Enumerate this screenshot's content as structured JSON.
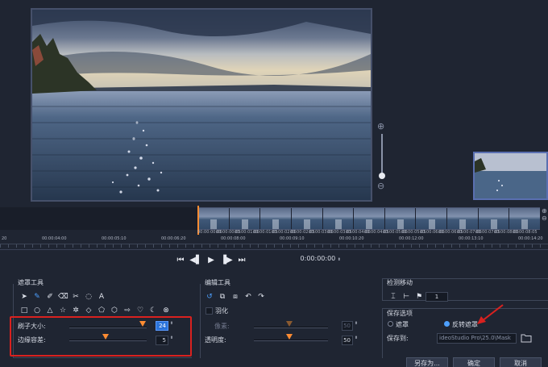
{
  "timeline": {
    "ruler_top": [
      "00:00:00:00",
      "00:00:00:05",
      "00:00:01:00",
      "00:00:01:05",
      "00:00:02:00",
      "00:00:02:05",
      "00:00:03:00",
      "00:00:03:05",
      "00:00:04:00",
      "00:00:04:05",
      "00:00:05:00",
      "00:00:05:05",
      "00:00:06:00",
      "00:00:06:05",
      "00:00:07:00",
      "00:00:07:05",
      "00:00:08:00",
      "00:00:08:05"
    ],
    "ruler_bottom": [
      "20",
      "00:00:04:00",
      "00:00:05:10",
      "00:00:06:20",
      "00:00:08:00",
      "00:00:09:10",
      "00:00:10:20",
      "00:00:12:00",
      "00:00:13:10",
      "00:00:14:20"
    ]
  },
  "transport": {
    "buttons": [
      "first-frame",
      "prev-frame",
      "play",
      "next-frame",
      "last-frame"
    ],
    "timecode": "0:00:00:00"
  },
  "mask_tools": {
    "title": "遮罩工具",
    "brush_size_label": "刷子大小:",
    "brush_size_value": "24",
    "edge_tolerance_label": "边缘容差:",
    "edge_tolerance_value": "5",
    "highlight_color": "#d9211f"
  },
  "edit_tools": {
    "title": "编辑工具",
    "feather_label": "羽化",
    "pixels_label": "像素:",
    "pixels_value": "50",
    "opacity_label": "透明度:",
    "opacity_value": "50"
  },
  "tracking": {
    "title": "检测移动",
    "field_value": "1"
  },
  "save_options": {
    "title": "保存选项",
    "mask_option": "遮罩",
    "invert_mask_option": "反转遮罩",
    "save_to_label": "保存到:",
    "save_path": "ideoStudio Pro\\25.0\\Mask"
  },
  "buttons": {
    "save_as": "另存为...",
    "ok": "确定",
    "cancel": "取消"
  },
  "colors": {
    "accent": "#ff8c32",
    "selection": "#2b73d8",
    "background": "#1f2532"
  }
}
